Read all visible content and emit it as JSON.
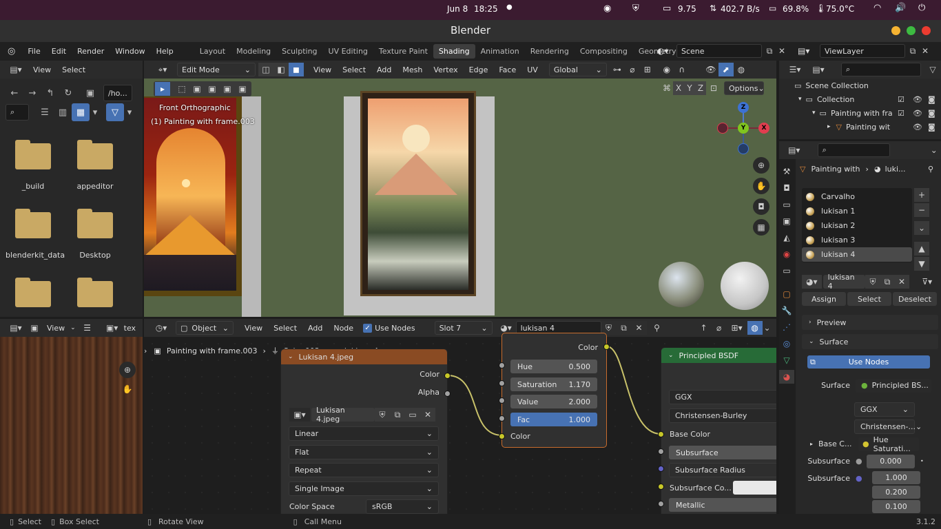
{
  "system_bar": {
    "date": "Jun 8",
    "time": "18:25",
    "volume_percent": "9.75",
    "network": "402.7 B/s",
    "battery": "69.8%",
    "temperature": "75.0°C"
  },
  "window": {
    "title": "Blender"
  },
  "menubar": {
    "items": [
      "File",
      "Edit",
      "Render",
      "Window",
      "Help"
    ]
  },
  "workspaces": {
    "tabs": [
      "Layout",
      "Modeling",
      "Sculpting",
      "UV Editing",
      "Texture Paint",
      "Shading",
      "Animation",
      "Rendering",
      "Compositing",
      "Geometry No"
    ],
    "active": "Shading"
  },
  "scene": {
    "label": "Scene"
  },
  "view_layer": {
    "label": "ViewLayer"
  },
  "file_browser": {
    "menus": [
      "View",
      "Select"
    ],
    "path": "/ho...",
    "items": [
      "_build",
      "appeditor",
      "blenderkit_data",
      "Desktop",
      "",
      ""
    ]
  },
  "viewport": {
    "mode": "Edit Mode",
    "menus": [
      "View",
      "Select",
      "Add",
      "Mesh",
      "Vertex",
      "Edge",
      "Face",
      "UV"
    ],
    "orientation": "Global",
    "view_name": "Front Orthographic",
    "object_info": "(1) Painting with frame.003",
    "options": "Options",
    "axes": [
      "X",
      "Y",
      "Z"
    ],
    "gizmo": {
      "z": "Z",
      "y": "Y",
      "x": "X"
    }
  },
  "outliner": {
    "root": "Scene Collection",
    "collection": "Collection",
    "item1": "Painting with fra",
    "item2": "Painting wit"
  },
  "properties": {
    "breadcrumb_object": "Painting with",
    "breadcrumb_material": "luki...",
    "materials": [
      "Carvalho",
      "lukisan 1",
      "lukisan 2",
      "lukisan 3",
      "lukisan 4"
    ],
    "material_name": "lukisan 4",
    "assign": "Assign",
    "select": "Select",
    "deselect": "Deselect",
    "preview": "Preview",
    "surface_panel": "Surface",
    "use_nodes": "Use Nodes",
    "surface_label": "Surface",
    "surface_value": "Principled BS...",
    "dist": "GGX",
    "sss_method": "Christensen-...",
    "base_color_label": "Base C...",
    "base_color_value": "Hue Saturati...",
    "subsurface_label": "Subsurface",
    "subsurface_value": "0.000",
    "subsurface_radius_label": "Subsurface",
    "radius_values": [
      "1.000",
      "0.200",
      "0.100"
    ]
  },
  "image_editor": {
    "view": "View",
    "texture": "tex"
  },
  "node_editor": {
    "type": "Object",
    "menus": [
      "View",
      "Select",
      "Add",
      "Node"
    ],
    "use_nodes": "Use Nodes",
    "slot": "Slot 7",
    "material": "lukisan 4",
    "breadcrumb": [
      "Painting with frame.003",
      "Cube.003",
      "lukisan 4"
    ],
    "image_node": {
      "title": "Lukisan 4.jpeg",
      "out_color": "Color",
      "out_alpha": "Alpha",
      "image": "Lukisan 4.jpeg",
      "interp": "Linear",
      "projection": "Flat",
      "extension": "Repeat",
      "source": "Single Image",
      "color_space_label": "Color Space",
      "color_space": "sRGB"
    },
    "hsv_node": {
      "out_color": "Color",
      "hue_label": "Hue",
      "hue": "0.500",
      "sat_label": "Saturation",
      "sat": "1.170",
      "val_label": "Value",
      "val": "2.000",
      "fac_label": "Fac",
      "fac": "1.000",
      "in_color": "Color"
    },
    "bsdf_node": {
      "title": "Principled BSDF",
      "dist": "GGX",
      "sss": "Christensen-Burley",
      "base_color": "Base Color",
      "subsurface": "Subsurface",
      "subsurface_radius": "Subsurface Radius",
      "subsurface_color": "Subsurface Co...",
      "metallic": "Metallic"
    }
  },
  "status_bar": {
    "select": "Select",
    "box_select": "Box Select",
    "rotate": "Rotate View",
    "call_menu": "Call Menu",
    "version": "3.1.2"
  }
}
